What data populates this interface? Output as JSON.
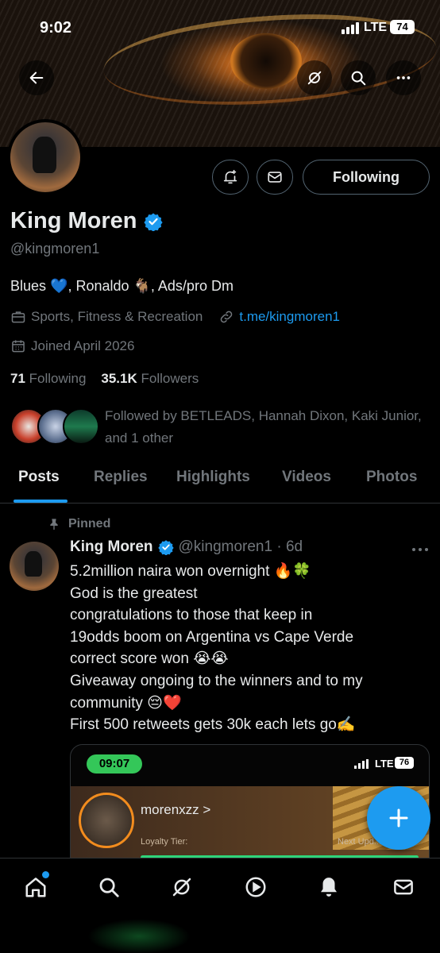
{
  "status_bar": {
    "time": "9:02",
    "network": "LTE",
    "battery": "74"
  },
  "profile": {
    "name": "King Moren",
    "handle": "@kingmoren1",
    "bio": "Blues 💙, Ronaldo 🐐, Ads/pro Dm",
    "category": "Sports, Fitness & Recreation",
    "link": "t.me/kingmoren1",
    "joined": "Joined April 2026",
    "following_count": "71",
    "following_label": "Following",
    "followers_count": "35.1K",
    "followers_label": "Followers",
    "followed_by": "Followed by BETLEADS, Hannah Dixon, Kaki Junior, and 1 other",
    "follow_button": "Following"
  },
  "tabs": [
    "Posts",
    "Replies",
    "Highlights",
    "Videos",
    "Photos"
  ],
  "active_tab": "Posts",
  "post": {
    "pinned_label": "Pinned",
    "author": "King Moren",
    "handle_time": "@kingmoren1 · 6d",
    "text": "5.2million naira won overnight 🔥🍀\nGod is the greatest\ncongratulations to those that keep in\n19odds boom on Argentina vs Cape Verde\ncorrect score won 😭😭\nGiveaway ongoing to the winners and to my\ncommunity 😔❤️\nFirst 500 retweets gets 30k each lets go✍️",
    "media": {
      "time": "09:07",
      "network": "LTE",
      "battery": "76",
      "username": "morenxzz  >",
      "loyalty_label": "Loyalty Tier:",
      "next_label": "Next Upd..."
    }
  },
  "colors": {
    "accent": "#1d9bf0",
    "muted": "#71767b",
    "text": "#e7e9ea",
    "border": "#2f3336"
  },
  "icons": {
    "back": "arrow-left-icon",
    "grok": "grok-icon",
    "search": "search-icon",
    "more": "more-icon",
    "notify": "bell-plus-icon",
    "message": "envelope-icon",
    "verified": "verified-badge-icon",
    "briefcase": "briefcase-icon",
    "link": "link-icon",
    "calendar": "calendar-icon",
    "pin": "pin-icon",
    "compose": "plus-icon",
    "nav": [
      "home-icon",
      "search-icon",
      "grok-icon",
      "play-icon",
      "bell-icon",
      "envelope-icon"
    ]
  }
}
